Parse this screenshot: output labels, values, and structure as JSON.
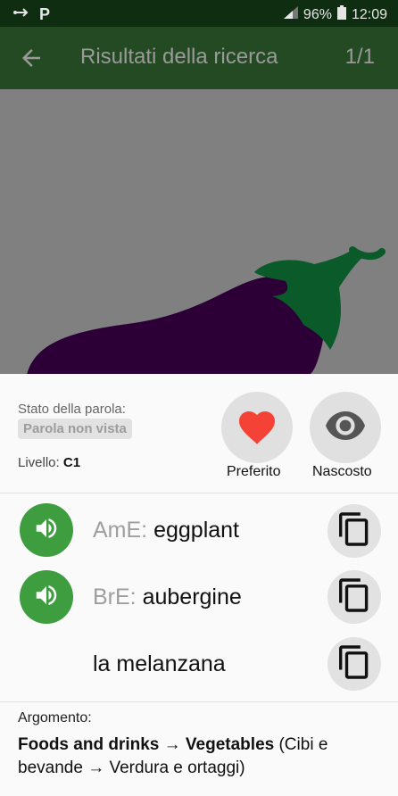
{
  "status_bar": {
    "battery": "96%",
    "time": "12:09",
    "icons": [
      "usb-icon",
      "p-icon",
      "signal-icon",
      "battery-icon"
    ]
  },
  "app_bar": {
    "title": "Risultati della ricerca",
    "counter": "1/1"
  },
  "word_state": {
    "label": "Stato della parola:",
    "badge": "Parola non vista",
    "level_label": "Livello:",
    "level_value": "C1"
  },
  "actions": {
    "favorite_label": "Preferito",
    "hidden_label": "Nascosto"
  },
  "translations": [
    {
      "prefix": "AmE:",
      "word": "eggplant"
    },
    {
      "prefix": "BrE:",
      "word": "aubergine"
    },
    {
      "prefix": "",
      "word": "la melanzana"
    }
  ],
  "topic": {
    "label": "Argomento:",
    "category": "Foods and drinks",
    "arrow": "→",
    "subcategory": "Vegetables",
    "translation_open": "(Cibi e bevande ",
    "translation_sub": "Verdura e ortaggi)"
  },
  "colors": {
    "status_bar": "#0f2d10",
    "app_bar": "#234a22",
    "speaker_green": "#3d9d3f",
    "heart_red": "#f44336",
    "eggplant_purple": "#2c0037",
    "leaf_green": "#0a5a2a"
  }
}
